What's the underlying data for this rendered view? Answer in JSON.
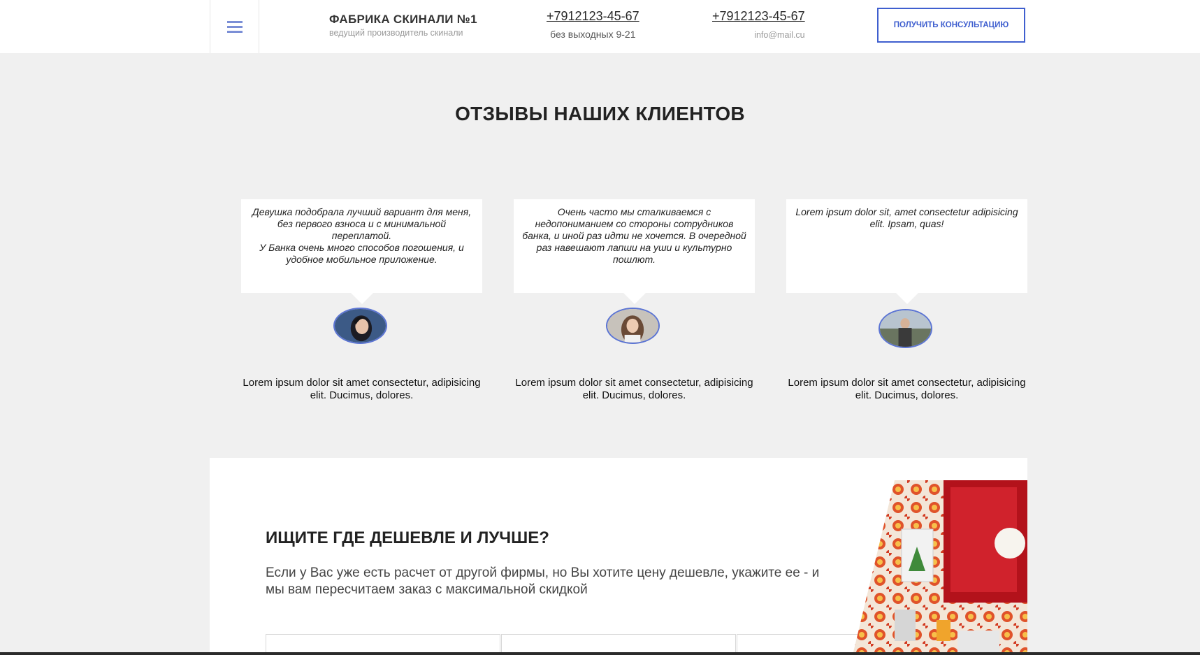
{
  "header": {
    "brand_title": "ФАБРИКА СКИНАЛИ №1",
    "brand_subtitle": "ведущий производитель скинали",
    "contact1": {
      "phone": "+7912123-45-67",
      "sub": "без выходных 9-21"
    },
    "contact2": {
      "phone": "+7912123-45-67",
      "sub": "info@mail.cu"
    },
    "consult_button": "ПОЛУЧИТЬ КОНСУЛЬТАЦИЮ"
  },
  "reviews": {
    "title": "ОТЗЫВЫ НАШИХ КЛИЕНТОВ",
    "items": [
      {
        "text": "Девушка подобрала лучший вариант для меня,\nбез первого взноса и с минимальной переплатой.\nУ Банка очень много способов погошения, и удобное мобильное приложение.",
        "name": "Lorem ipsum dolor sit amet consectetur, adipisicing elit. Ducimus, dolores."
      },
      {
        "text": "Очень часто мы сталкиваемся с недопониманием со стороны сотрудников банка, и иной раз идти не хочется. В очередной\nраз навешают лапши на уши и культурно пошлют.",
        "name": "Lorem ipsum dolor sit amet consectetur, adipisicing elit. Ducimus, dolores."
      },
      {
        "text": "Lorem ipsum dolor sit, amet consectetur adipisicing elit. Ipsam, quas!",
        "name": "Lorem ipsum dolor sit amet consectetur, adipisicing elit. Ducimus, dolores."
      }
    ]
  },
  "promo": {
    "title": "ИЩИТЕ ГДЕ ДЕШЕВЛЕ И ЛУЧШЕ?",
    "text": "Если у Вас уже есть расчет от другой фирмы, но Вы хотите цену дешевле, укажите ее - и мы вам пересчитаем заказ с максимальной скидкой"
  },
  "colors": {
    "accent": "#3f5fcf",
    "menu_icon": "#7b8fd6",
    "background": "#f0f0f0"
  },
  "icons": [
    "menu-icon"
  ]
}
